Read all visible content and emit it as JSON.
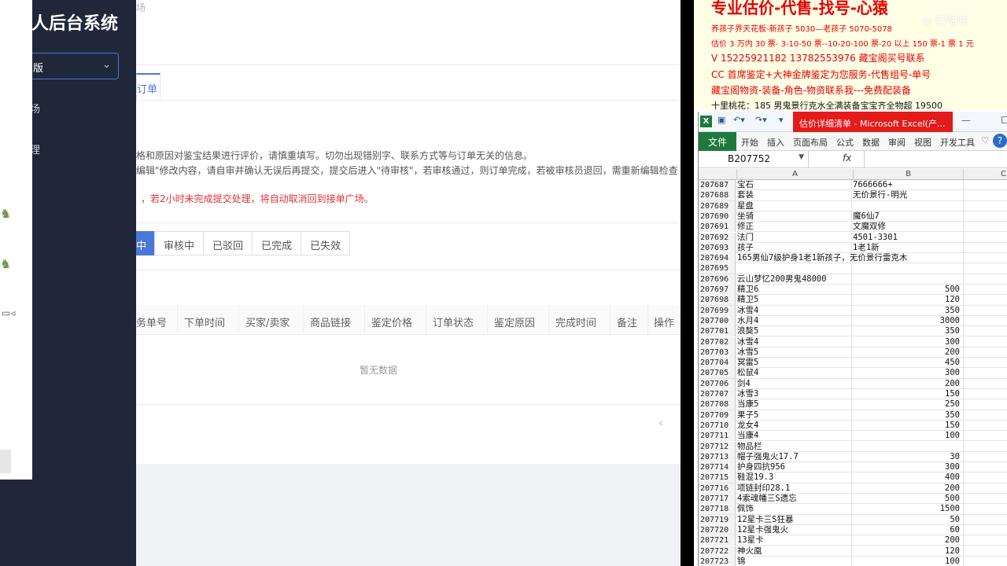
{
  "app": {
    "title": "人后台系统",
    "version_select": "版",
    "nav": [
      "场",
      "理"
    ],
    "breadcrumb": "场",
    "tab_label": "订单",
    "instructions": [
      "格和原因对鉴宝结果进行评价，请慎重填写。切勿出现错别字、联系方式等与订单无关的信息。",
      "编辑\"修改内容，请自审并确认无误后再提交，提交后进入\"待审核\"，若审核通过，则订单完成，若被审核员退回，需重新编辑检查"
    ],
    "warning": "，若2小时未完成提交处理，将自动取消回到接单广场。",
    "filters": [
      {
        "label": "中",
        "active": true
      },
      {
        "label": "审核中",
        "active": false
      },
      {
        "label": "已驳回",
        "active": false
      },
      {
        "label": "已完成",
        "active": false
      },
      {
        "label": "已失效",
        "active": false
      }
    ],
    "table_headers": [
      "务单号",
      "下单时间",
      "买家/卖家",
      "商品链接",
      "鉴定价格",
      "订单状态",
      "鉴定原因",
      "完成时间",
      "备注",
      "操作"
    ],
    "empty_text": "暂无数据",
    "pager_prev": "‹",
    "accent_color": "#4a78d6",
    "sidebar_color": "#21273b"
  },
  "notice": {
    "lines": [
      "专业估价-代售-找号-心猿",
      "养孩子界天花板-新孩子 5030—老孩子 5070-5078",
      "估价 3 万内 30 票- 3-10-50 票--10-20-100 票-20 以上 150 票-1 票 1 元",
      "V 15225921182      13782553976    藏宝阁买号联系",
      "CC 首席鉴定+大神金牌鉴定为您服务-代售组号-单号",
      "藏宝阁物资-装备-角色-物资联系我---免费配装备",
      "十里桃花：185 男鬼景行克水全满装备宝宝齐全物超 19500"
    ],
    "watermark": "◎ 已咕咕"
  },
  "excel": {
    "window_title": "估价详细清单 - Microsoft Excel(产...",
    "ribbon_tabs": [
      "文件",
      "开始",
      "插入",
      "页面布局",
      "公式",
      "数据",
      "审阅",
      "视图",
      "开发工具"
    ],
    "name_box": "B207752",
    "columns": [
      "A",
      "B",
      "C"
    ],
    "rows": [
      {
        "n": "207687",
        "a": "宝石",
        "b": "7666666+",
        "num": false
      },
      {
        "n": "207688",
        "a": "套装",
        "b": "无价景行-明光",
        "num": false
      },
      {
        "n": "207689",
        "a": "星盘",
        "b": "",
        "num": false
      },
      {
        "n": "207690",
        "a": "坐骑",
        "b": "魔6仙7",
        "num": false
      },
      {
        "n": "207691",
        "a": "修正",
        "b": "文魔双修",
        "num": false
      },
      {
        "n": "207692",
        "a": "法门",
        "b": "4501-3301",
        "num": false
      },
      {
        "n": "207693",
        "a": "孩子",
        "b": "1老1新",
        "num": false
      },
      {
        "n": "207694",
        "a": "165男仙7级护身1老1新孩子，无价景行雷克木",
        "b": "",
        "num": false
      },
      {
        "n": "207695",
        "a": "",
        "b": "",
        "num": false
      },
      {
        "n": "207696",
        "a": "云山梦忆200男鬼48000",
        "b": "",
        "num": false
      },
      {
        "n": "207697",
        "a": "精卫6",
        "b": "500",
        "num": true
      },
      {
        "n": "207698",
        "a": "精卫5",
        "b": "120",
        "num": true
      },
      {
        "n": "207699",
        "a": "冰雪4",
        "b": "350",
        "num": true
      },
      {
        "n": "207700",
        "a": "水月4",
        "b": "3000",
        "num": true
      },
      {
        "n": "207701",
        "a": "浪獒5",
        "b": "350",
        "num": true
      },
      {
        "n": "207702",
        "a": "冰雪4",
        "b": "300",
        "num": true
      },
      {
        "n": "207703",
        "a": "冰雪5",
        "b": "200",
        "num": true
      },
      {
        "n": "207704",
        "a": "冥雷5",
        "b": "450",
        "num": true
      },
      {
        "n": "207705",
        "a": "松鼠4",
        "b": "300",
        "num": true
      },
      {
        "n": "207706",
        "a": "剑4",
        "b": "200",
        "num": true
      },
      {
        "n": "207707",
        "a": "冰雪3",
        "b": "150",
        "num": true
      },
      {
        "n": "207708",
        "a": "当康5",
        "b": "250",
        "num": true
      },
      {
        "n": "207709",
        "a": "果子5",
        "b": "350",
        "num": true
      },
      {
        "n": "207710",
        "a": "龙女4",
        "b": "150",
        "num": true
      },
      {
        "n": "207711",
        "a": "当康4",
        "b": "100",
        "num": true
      },
      {
        "n": "207712",
        "a": "物品栏",
        "b": "",
        "num": false
      },
      {
        "n": "207713",
        "a": "帽子强鬼火17.7",
        "b": "30",
        "num": true
      },
      {
        "n": "207714",
        "a": "护身四抗956",
        "b": "300",
        "num": true
      },
      {
        "n": "207715",
        "a": "鞋混19.3",
        "b": "400",
        "num": true
      },
      {
        "n": "207716",
        "a": "项链封印28.1",
        "b": "200",
        "num": true
      },
      {
        "n": "207717",
        "a": "4索魂幡三S遗忘",
        "b": "500",
        "num": true
      },
      {
        "n": "207718",
        "a": "佩饰",
        "b": "1500",
        "num": true
      },
      {
        "n": "207719",
        "a": "12星卡三S狂暴",
        "b": "50",
        "num": true
      },
      {
        "n": "207720",
        "a": "12星卡强鬼火",
        "b": "60",
        "num": true
      },
      {
        "n": "207721",
        "a": "13星卡",
        "b": "200",
        "num": true
      },
      {
        "n": "207722",
        "a": "神火凰",
        "b": "120",
        "num": true
      },
      {
        "n": "207723",
        "a": "锦",
        "b": "100",
        "num": true
      }
    ]
  }
}
